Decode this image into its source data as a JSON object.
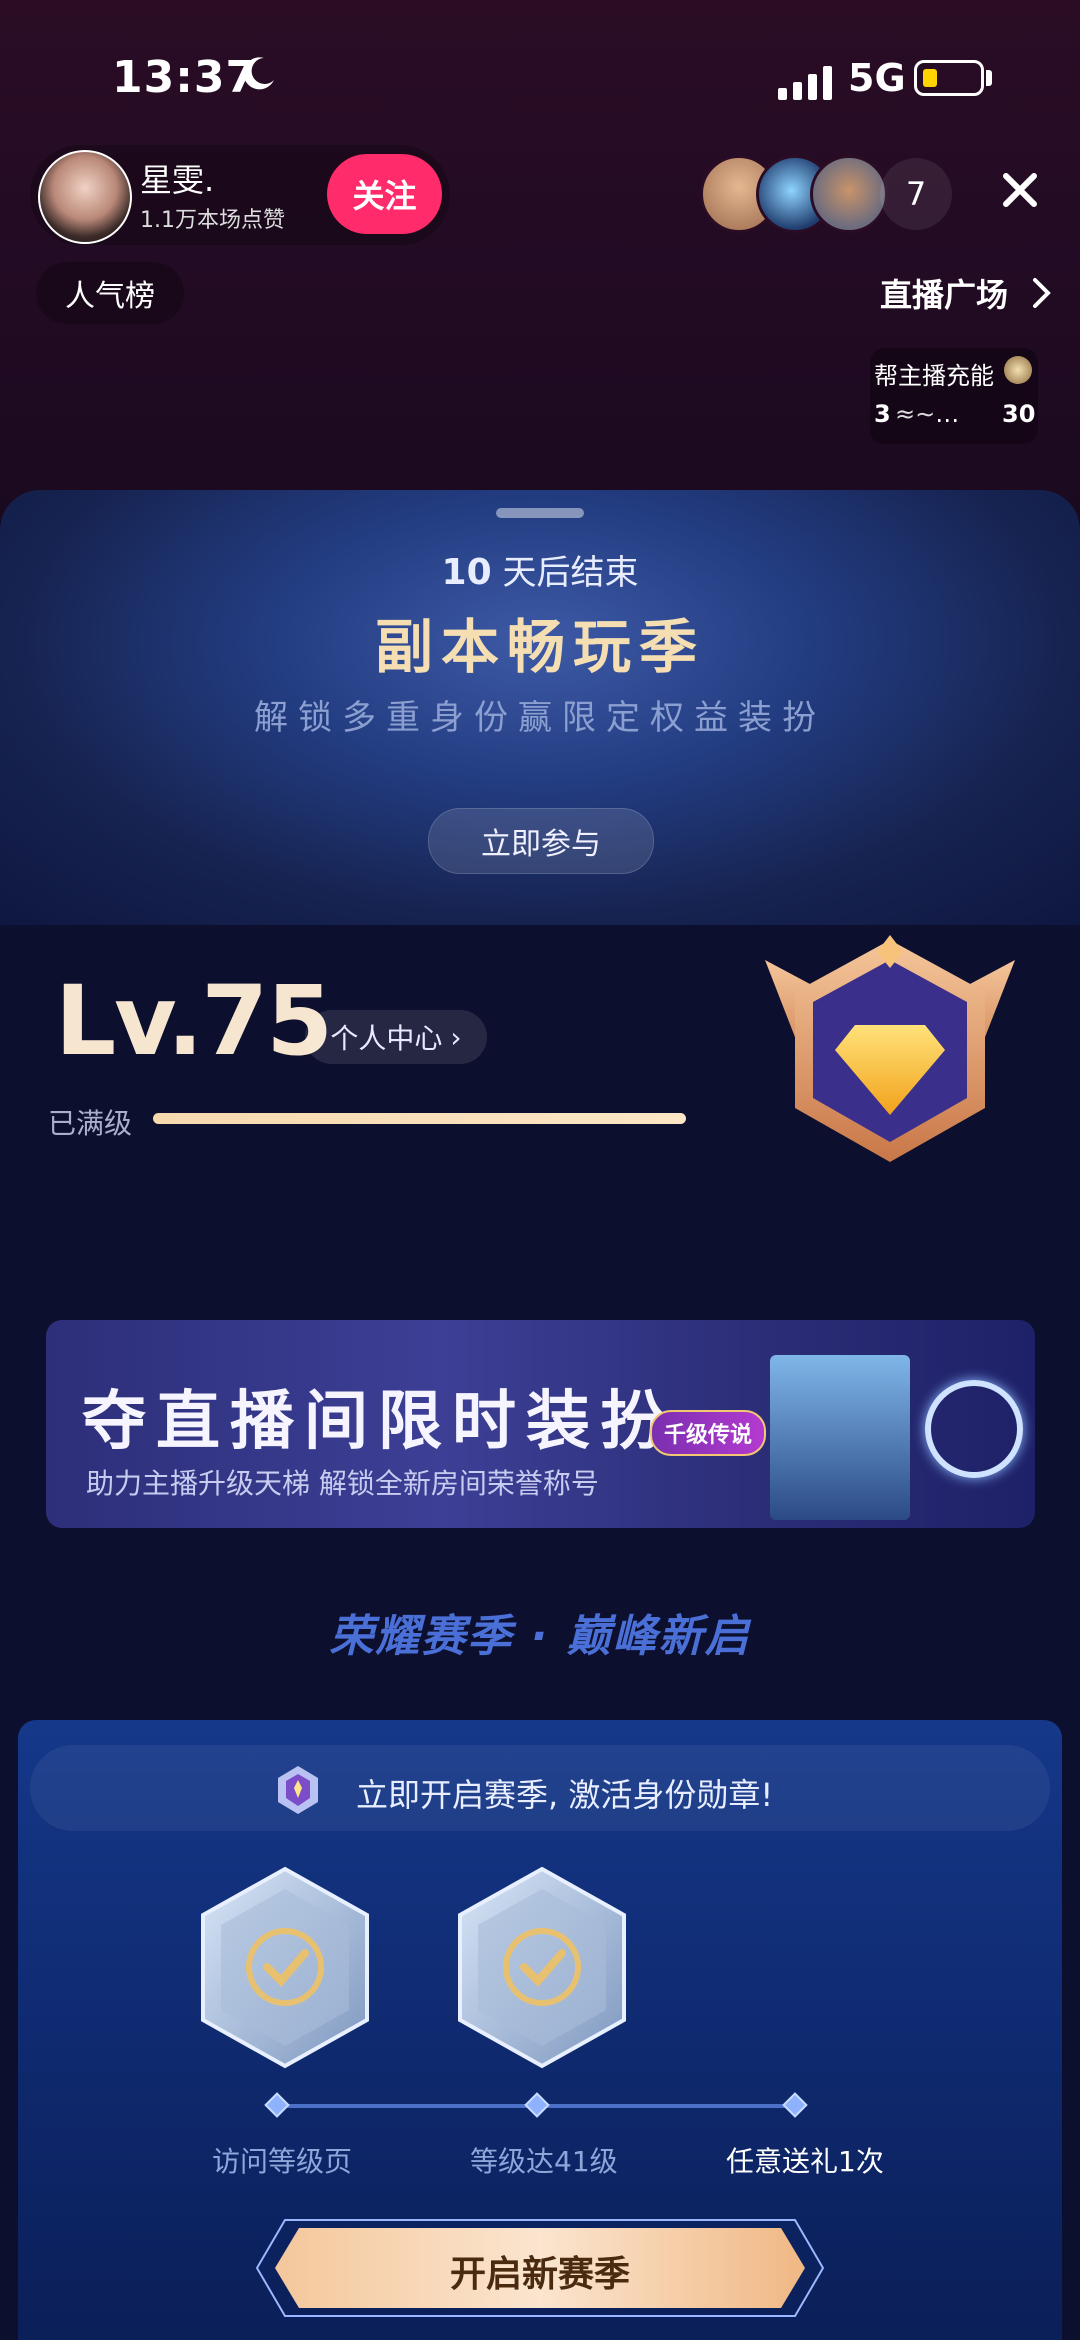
{
  "status": {
    "time": "13:37",
    "network": "5G"
  },
  "host": {
    "name": "星雯.",
    "likes": "1.1万本场点赞",
    "follow_label": "关注"
  },
  "viewers": {
    "count": "7"
  },
  "top_nav": {
    "ranking": "人气榜",
    "plaza": "直播广场"
  },
  "charge": {
    "title": "帮主播充能",
    "left": "3",
    "mid": "…",
    "right": "30"
  },
  "season_banner": {
    "days": "10",
    "ends_suffix": "天后结束",
    "title": "副本畅玩季",
    "subtitle": "解锁多重身份赢限定权益装扮",
    "join_label": "立即参与"
  },
  "level": {
    "value": "Lv.75",
    "center_label": "个人中心",
    "status": "已满级",
    "progress": 1.0
  },
  "promo": {
    "title": "夺直播间限时装扮",
    "subtitle": "助力主播升级天梯 解锁全新房间荣誉称号",
    "tag": "千级传说"
  },
  "glory_heading": "荣耀赛季 · 巅峰新启",
  "season_tasks": {
    "prompt": "立即开启赛季, 激活身份勋章!",
    "steps": [
      {
        "label": "访问等级页",
        "done": true
      },
      {
        "label": "等级达41级",
        "done": true
      },
      {
        "label": "任意送礼1次",
        "done": false
      }
    ],
    "cta_label": "开启新赛季"
  },
  "colors": {
    "follow": "#ff2b6a",
    "gold": "#f5dfb2",
    "panel": "#0d0f2e",
    "accent_blue": "#4b72c8"
  },
  "icons": [
    "moon-icon",
    "signal-icon",
    "battery-icon",
    "close-icon",
    "chevron-right-icon",
    "diamond-badge-icon",
    "check-hex-icon",
    "medal-icon"
  ]
}
